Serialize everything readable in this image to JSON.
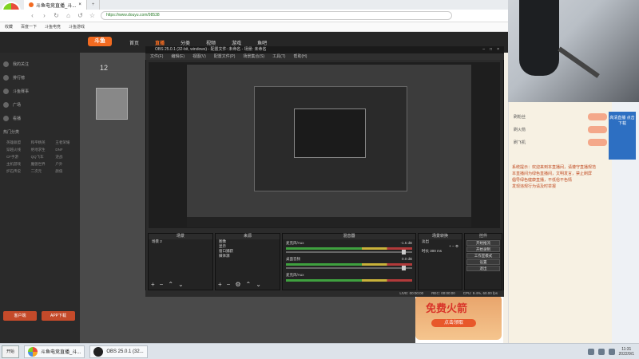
{
  "browser": {
    "tabs": [
      {
        "label": "斗鱼电竞直播_斗...",
        "active": true
      },
      {
        "label": "",
        "active": false
      }
    ],
    "url": "https://www.douyu.com/98538",
    "bookmarks": [
      "收藏",
      "百度一下",
      "斗鱼电竞",
      "斗鱼游戏"
    ]
  },
  "site": {
    "nav": [
      "首页",
      "直播",
      "分类",
      "视频",
      "游戏",
      "鱼吧"
    ],
    "left_nav": [
      "我的关注",
      "排行榜",
      "斗鱼赛事",
      "广场",
      "看播"
    ],
    "section_label": "热门分类",
    "categories": [
      "英雄联盟",
      "和平精英",
      "王者荣耀",
      "穿越火线",
      "绝地求生",
      "DNF",
      "CF手游",
      "QQ飞车",
      "逆战",
      "主机游戏",
      "魔兽世界",
      "户外",
      "炉石传说",
      "二次元",
      "颜值"
    ],
    "left_buttons": [
      "客户端",
      "APP下载"
    ],
    "room_count": "12",
    "promo_title": "免费火箭",
    "promo_button": "点击领取"
  },
  "chat": {
    "lines": [
      "系统提示：欢迎来到本直播间，请遵守直播规范",
      "本直播间为绿色直播间，文明发言，禁止刷屏",
      "倡导绿色健康直播，不低俗不色情",
      "发现违规行为请及时举报"
    ],
    "gift_rows": [
      "刷粉丝",
      "刷火箭",
      "刷飞机"
    ]
  },
  "ad": {
    "text": "高清直播 点击下载"
  },
  "obs": {
    "title": "OBS 25.0.1 (32-bit, windows) - 配置文件: 未命名 - 场景: 未命名",
    "menu": [
      "文件(F)",
      "编辑(E)",
      "视图(V)",
      "配置文件(P)",
      "场景集合(S)",
      "工具(T)",
      "帮助(H)"
    ],
    "docks": {
      "scenes": {
        "title": "场景",
        "items": [
          "场景 2"
        ]
      },
      "sources": {
        "title": "来源",
        "items": [
          "图像",
          "显示",
          "窗口捕获",
          "媒体源"
        ]
      },
      "mixer": {
        "title": "混音器",
        "channels": [
          {
            "name": "麦克风/Aux",
            "db": "-1.5 dB"
          },
          {
            "name": "桌面音频",
            "db": "0.0 dB"
          },
          {
            "name": "麦克风/Aux",
            "db": ""
          }
        ]
      },
      "transitions": {
        "title": "场景转换",
        "type": "淡出",
        "duration_label": "时长",
        "duration": "300 ms"
      },
      "controls": {
        "title": "控件",
        "buttons": [
          "开始推流",
          "开始录制",
          "工作室模式",
          "设置",
          "退出"
        ]
      }
    },
    "status": {
      "live": "LIVE: 00:00:00",
      "rec": "REC: 00:00:00",
      "cpu": "CPU: 9.4%, 60.00 fps"
    }
  },
  "taskbar": {
    "start": "开始",
    "tasks": [
      "斗鱼电竞直播_斗...",
      "OBS 25.0.1 (32..."
    ],
    "time": "11:31",
    "date": "2022/9/1"
  }
}
